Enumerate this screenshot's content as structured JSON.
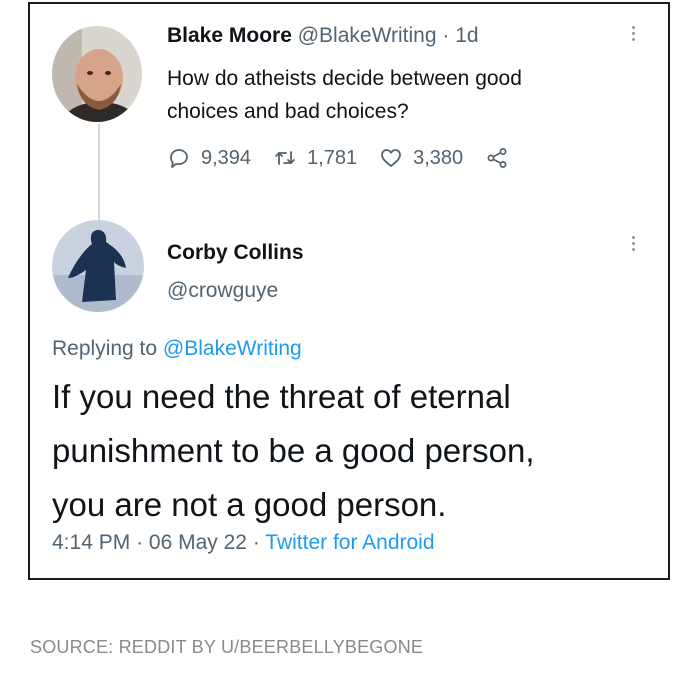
{
  "original_tweet": {
    "display_name": "Blake Moore",
    "handle": "@BlakeWriting",
    "separator": "·",
    "age": "1d",
    "text_line1": "How do atheists decide between good",
    "text_line2": "choices and bad choices?",
    "replies": "9,394",
    "retweets": "1,781",
    "likes": "3,380"
  },
  "reply_tweet": {
    "display_name": "Corby Collins",
    "handle": "@crowguye",
    "replying_prefix": "Replying to",
    "replying_to": "@BlakeWriting",
    "text_line1": "If you need the threat of eternal",
    "text_line2": "punishment to be a good person,",
    "text_line3": "you are not a good person.",
    "time": "4:14 PM",
    "separator": "·",
    "date": "06 May 22",
    "client": "Twitter for Android"
  },
  "source_caption": "SOURCE: REDDIT BY U/BEERBELLYBEGONE",
  "colors": {
    "link_blue": "#1d9bf0",
    "muted_gray": "#536471",
    "text_black": "#0f1419"
  },
  "icons": [
    "reply-icon",
    "retweet-icon",
    "like-icon",
    "share-icon",
    "more-options-icon"
  ]
}
